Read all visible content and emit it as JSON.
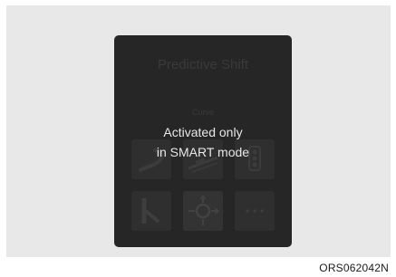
{
  "screen": {
    "title": "Predictive Shift",
    "section_label": "Curve",
    "overlay_message": {
      "line1": "Activated only",
      "line2": "in SMART mode"
    },
    "tiles": [
      {
        "icon": "curve-road-icon"
      },
      {
        "icon": "downhill-slope-icon"
      },
      {
        "icon": "traffic-light-icon"
      },
      {
        "icon": "ramp-merge-icon"
      },
      {
        "icon": "roundabout-icon"
      },
      {
        "icon": "more-options-icon"
      }
    ]
  },
  "figure_code": "ORS062042N",
  "colors": {
    "background": "#e8e8e8",
    "screen": "#262626",
    "overlay_text": "#e8e8e8"
  }
}
